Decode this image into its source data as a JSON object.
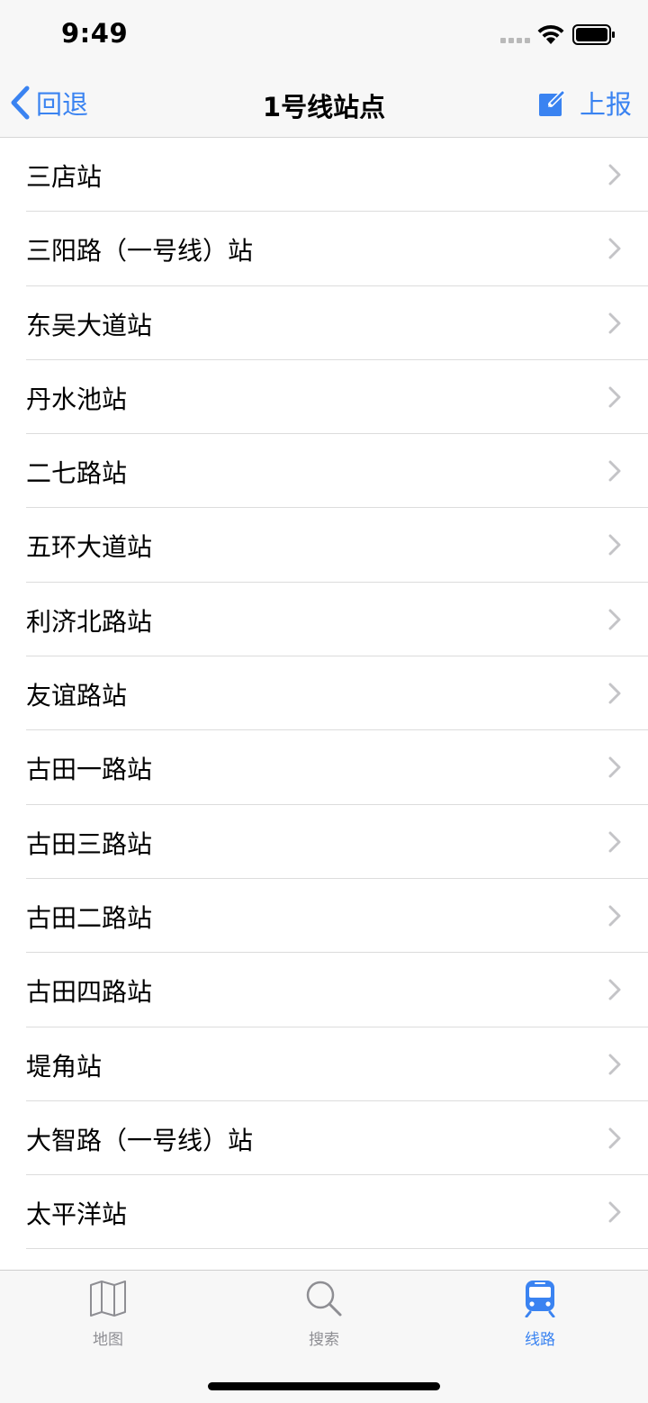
{
  "status": {
    "time": "9:49"
  },
  "nav": {
    "back_label": "回退",
    "title": "1号线站点",
    "report_label": "上报"
  },
  "stations": [
    "三店站",
    "三阳路（一号线）站",
    "东吴大道站",
    "丹水池站",
    "二七路站",
    "五环大道站",
    "利济北路站",
    "友谊路站",
    "古田一路站",
    "古田三路站",
    "古田二路站",
    "古田四路站",
    "堤角站",
    "大智路（一号线）站",
    "太平洋站"
  ],
  "tabs": [
    {
      "label": "地图",
      "icon": "map-icon"
    },
    {
      "label": "搜索",
      "icon": "search-icon"
    },
    {
      "label": "线路",
      "icon": "train-icon",
      "active": true
    }
  ],
  "colors": {
    "accent": "#3a83f1",
    "inactive": "#8e8e93",
    "bar_bg": "#f7f7f7"
  }
}
